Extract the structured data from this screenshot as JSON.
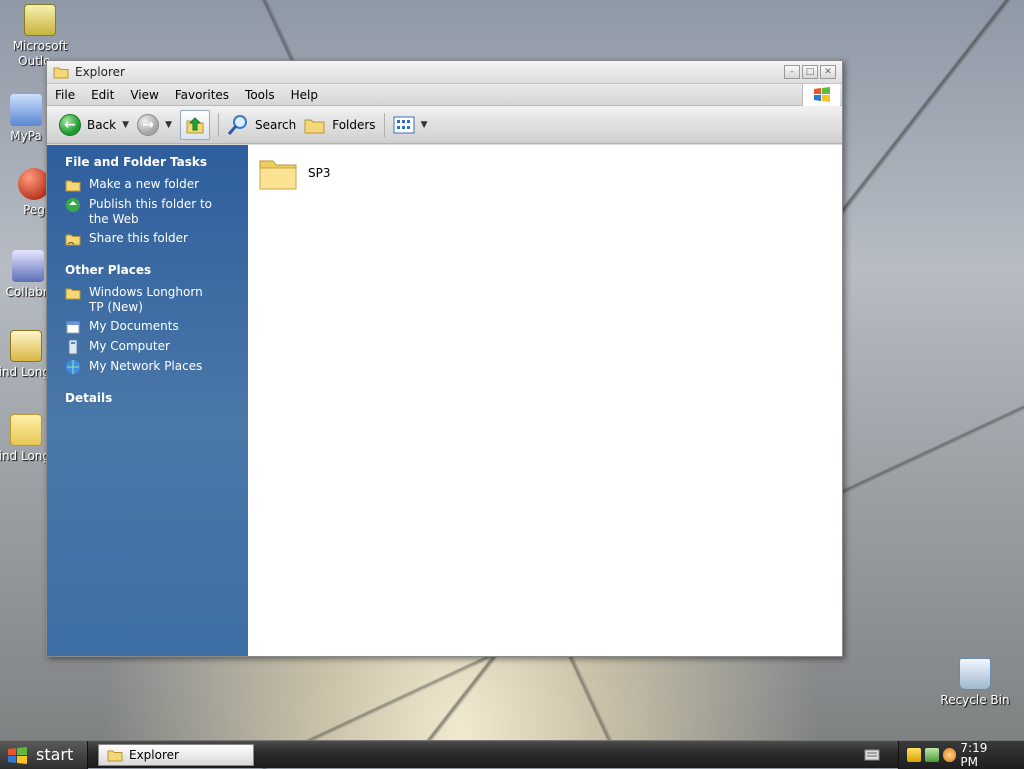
{
  "desktop": {
    "icons": [
      {
        "label": "Microsoft Outlo...",
        "icon": "outlook-icon"
      },
      {
        "label": "MyPa",
        "icon": "shortcut-icon"
      },
      {
        "label": "Peg",
        "icon": "app-icon"
      },
      {
        "label": "Collabn",
        "icon": "collaboration-icon"
      },
      {
        "label": "Wind Longho",
        "icon": "zip-icon"
      },
      {
        "label": "Wind Longho",
        "icon": "folder-icon"
      },
      {
        "label": "Recycle Bin",
        "icon": "recycle-bin-icon"
      }
    ]
  },
  "window": {
    "title": "Explorer",
    "menu": [
      "File",
      "Edit",
      "View",
      "Favorites",
      "Tools",
      "Help"
    ],
    "toolbar": {
      "back": "Back",
      "search": "Search",
      "folders": "Folders"
    }
  },
  "taskpane": {
    "file_folder_tasks": {
      "header": "File and Folder Tasks",
      "items": [
        "Make a new folder",
        "Publish this folder to the Web",
        "Share this folder"
      ]
    },
    "other_places": {
      "header": "Other Places",
      "items": [
        "Windows Longhorn TP (New)",
        "My Documents",
        "My Computer",
        "My Network Places"
      ]
    },
    "details": {
      "header": "Details"
    }
  },
  "content": {
    "items": [
      {
        "name": "SP3",
        "type": "folder"
      }
    ]
  },
  "taskbar": {
    "start": "start",
    "tasks": [
      "Explorer"
    ],
    "clock": "7:19 PM"
  },
  "colors": {
    "taskpane": "#3a68a2",
    "accent_green": "#1f9a2d",
    "folder": "#f4d878"
  }
}
